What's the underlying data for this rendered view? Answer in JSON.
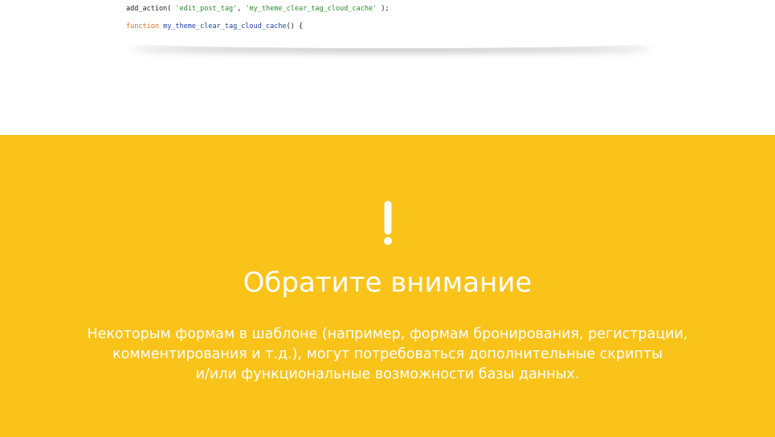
{
  "code": {
    "line1": {
      "fn": "add_action(",
      "sp1": " ",
      "arg1": "'edit_post_tag'",
      "sep": ", ",
      "arg2": "'my_theme_clear_tag_cloud_cache'",
      "end": " );"
    },
    "line2": {
      "kw": "function",
      "sp": " ",
      "name": "my_theme_clear_tag_cloud_cache",
      "end": "() {"
    }
  },
  "notice": {
    "icon": "exclamation-icon",
    "title": "Обратите внимание",
    "text_lines": [
      "Некоторым формам в шаблоне (например, формам бронирования, регистрации,",
      "комментирования и т.д.), могут потребоваться дополнительные скрипты",
      "и/или функциональные возможности базы данных."
    ]
  },
  "colors": {
    "notice_background": "#f9c31a",
    "notice_text": "#ffffff",
    "code_string": "#2e8b2e",
    "code_keyword": "#e86c1f",
    "code_function": "#1f47a8"
  }
}
